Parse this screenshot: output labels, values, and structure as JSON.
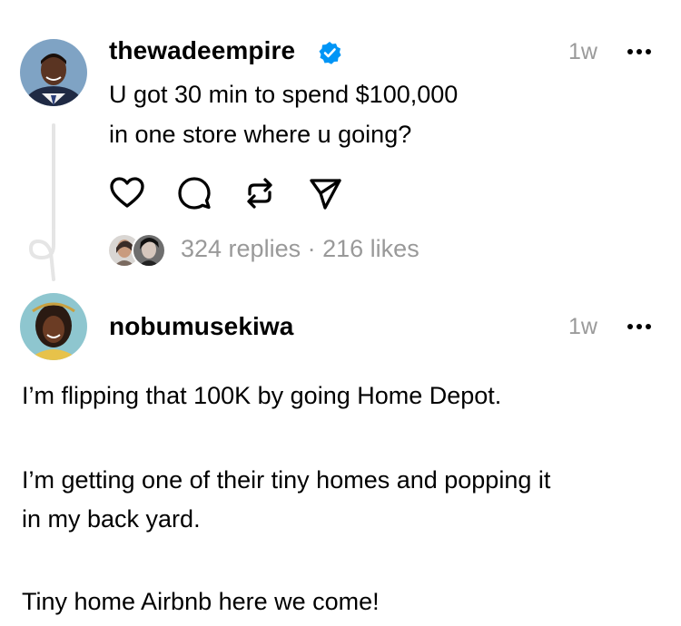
{
  "post": {
    "username": "thewadeempire",
    "time": "1w",
    "text_line1": "U got 30 min to spend $100,000",
    "text_line2": "in one store where u going?",
    "replies": "324 replies",
    "separator": "·",
    "likes": "216 likes",
    "verified": true
  },
  "reply": {
    "username": "nobumusekiwa",
    "time": "1w",
    "para1": "I’m flipping that 100K by going Home Depot.",
    "para2_line1": "I’m getting one of their tiny homes and popping it",
    "para2_line2": "in my back yard.",
    "para3": "Tiny home Airbnb here we come!"
  },
  "icons": {
    "verified_color": "#0095f6",
    "stroke_color": "#000000"
  }
}
